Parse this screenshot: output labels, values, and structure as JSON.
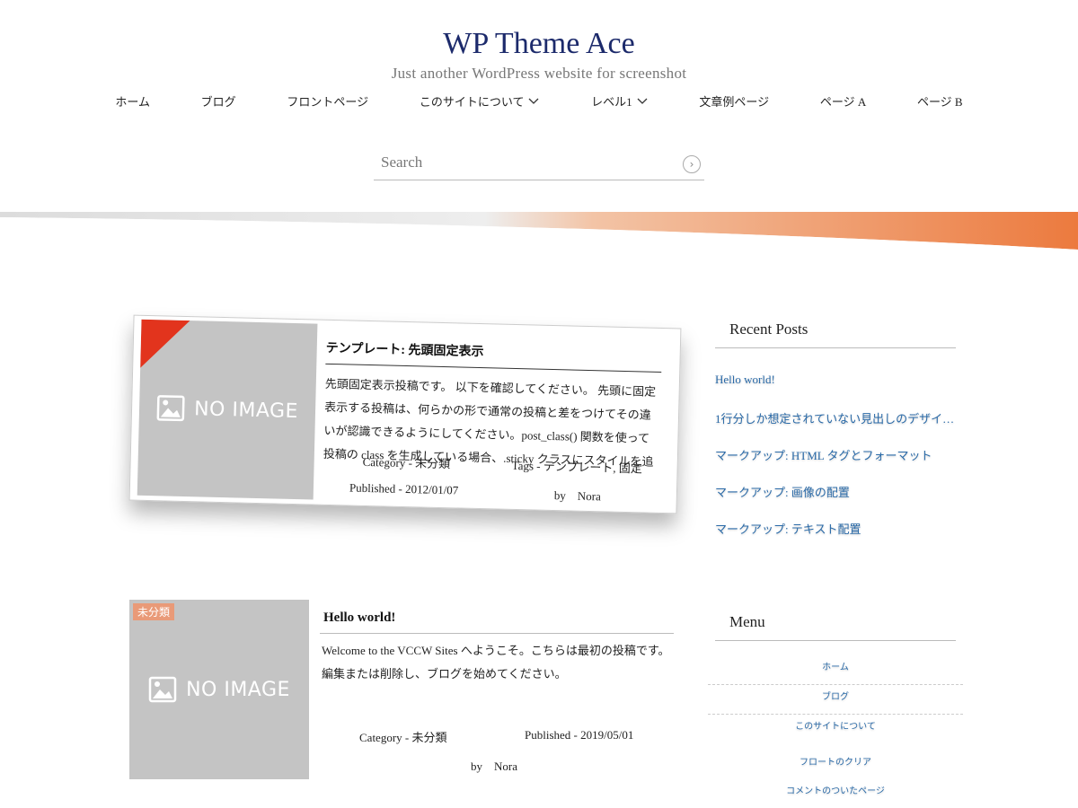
{
  "site": {
    "title": "WP Theme Ace",
    "description": "Just another WordPress website for screenshot"
  },
  "nav": {
    "items": [
      {
        "label": "ホーム"
      },
      {
        "label": "ブログ"
      },
      {
        "label": "フロントページ"
      },
      {
        "label": "このサイトについて",
        "has_children": true
      },
      {
        "label": "レベル1",
        "has_children": true
      },
      {
        "label": "文章例ページ"
      },
      {
        "label": "ページ A"
      },
      {
        "label": "ページ B"
      }
    ]
  },
  "search": {
    "placeholder": "Search",
    "button_icon": "arrow-right-circle-icon"
  },
  "colors": {
    "accent": "#ec7a3e",
    "title": "#1c2a6b",
    "link": "#2a6aa8",
    "sticky_ribbon": "#e2341d",
    "badge": "#e99a78"
  },
  "posts": [
    {
      "title": "テンプレート: 先頭固定表示",
      "excerpt": "先頭固定表示投稿です。 以下を確認してください。 先頭に固定表示する投稿は、何らかの形で通常の投稿と差をつけてその違いが認識できるようにしてください。post_class() 関数を使って投稿の class を生成している場合、.sticky クラスにスタイルを追加できま",
      "thumb_text": "NO IMAGE",
      "category": "Category - 未分類",
      "tags": "Tags - テンプレート, 固定",
      "published": "Published - 2012/01/07",
      "author": "by　Nora"
    },
    {
      "title": "Hello world!",
      "excerpt": "Welcome to the VCCW Sites へようこそ。こちらは最初の投稿です。編集または削除し、ブログを始めてください。",
      "thumb_text": "NO IMAGE",
      "badge": "未分類",
      "category": "Category - 未分類",
      "published": "Published - 2019/05/01",
      "author": "by　Nora"
    }
  ],
  "sidebar": {
    "recent_title": "Recent Posts",
    "recent": [
      "Hello world!",
      "1行分しか想定されていない見出しのデザイ…",
      "マークアップ: HTML タグとフォーマット",
      "マークアップ: 画像の配置",
      "マークアップ: テキスト配置"
    ],
    "menu_title": "Menu",
    "menu": [
      "ホーム",
      "ブログ",
      "このサイトについて",
      "フロートのクリア",
      "コメントのついたページ"
    ]
  }
}
